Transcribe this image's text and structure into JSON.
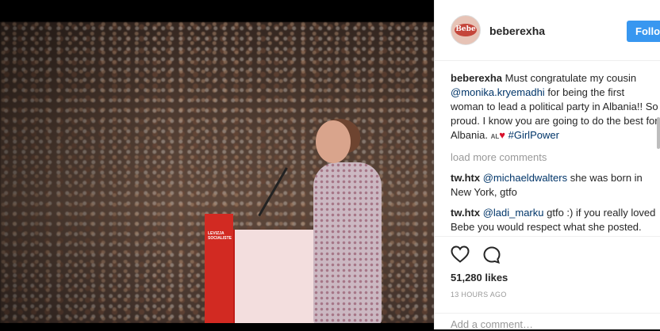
{
  "post": {
    "username": "beberexha",
    "follow_label": "Follow",
    "avatar_text": "Bebe",
    "caption": {
      "user": "beberexha",
      "text1": "Must congratulate my cousin",
      "mention": "@monika.kryemadhi",
      "text2": "for being the first woman to lead a political party in Albania!! So proud. I know you are going to do the best for Albania.",
      "flag_text": "AL",
      "hashtag": "#GirlPower"
    },
    "load_more_label": "load more comments",
    "comments": [
      {
        "user": "tw.htx",
        "mention": "@michaeldwalters",
        "text": "she was born in New York, gtfo"
      },
      {
        "user": "tw.htx",
        "mention": "@ladi_marku",
        "text": "gtfo :) if you really loved Bebe you would respect what she posted. don't be such a fake fan :)"
      }
    ],
    "likes": "51,280 likes",
    "time": "13 HOURS AGO",
    "add_comment_placeholder": "Add a comment…"
  },
  "photo": {
    "podium_text": "LEVIZJA SOCIALISTE"
  },
  "colors": {
    "follow_blue": "#3897f0",
    "link": "#003569",
    "heart_red": "#d8112b",
    "podium_red": "#d22a22"
  },
  "icons": {
    "like": "heart-outline-icon",
    "comment": "speech-bubble-icon",
    "flag": "albania-flag-icon"
  }
}
